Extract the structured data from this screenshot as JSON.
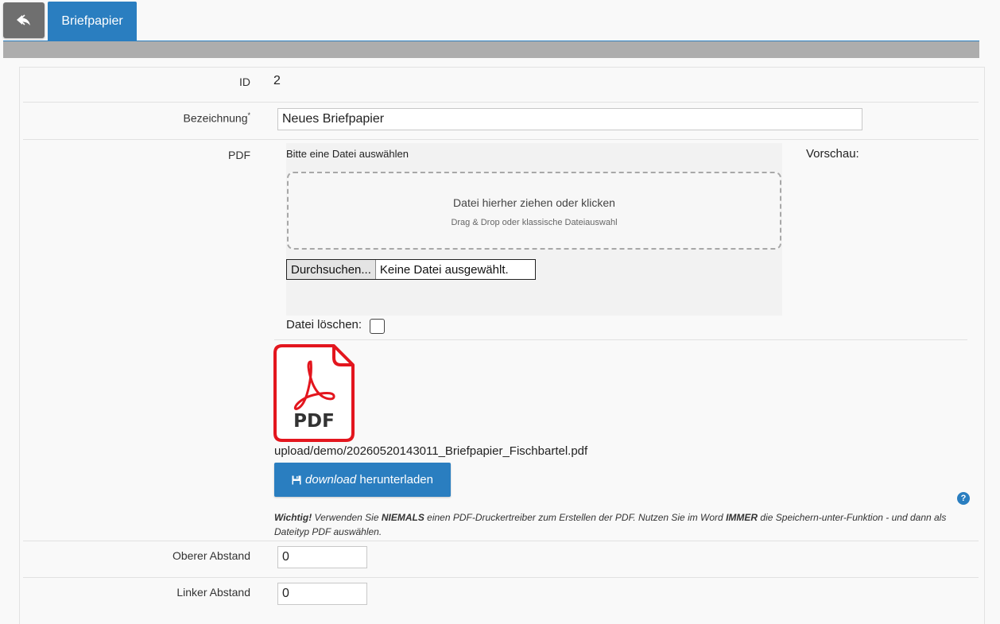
{
  "tabs": {
    "active_label": "Briefpapier"
  },
  "form": {
    "id": {
      "label": "ID",
      "value": "2"
    },
    "bezeichnung": {
      "label": "Bezeichnung",
      "required_mark": "*",
      "value": "Neues Briefpapier"
    },
    "pdf": {
      "label": "PDF",
      "select_hint": "Bitte eine Datei auswählen",
      "preview_label": "Vorschau:",
      "dropzone_title": "Datei hierher ziehen oder klicken",
      "dropzone_subtitle": "Drag & Drop oder klassische Dateiauswahl",
      "browse_label": "Durchsuchen...",
      "no_file_label": "Keine Datei ausgewählt.",
      "delete_label": "Datei löschen:",
      "icon_text": "PDF",
      "file_path": "upload/demo/20260520143011_Briefpapier_Fischbartel.pdf",
      "download_italic": "download",
      "download_text": "herunterladen",
      "note_prefix": "Wichtig!",
      "note_part1": " Verwenden Sie ",
      "note_strong1": "NIEMALS",
      "note_part2": " einen PDF-Druckertreiber zum Erstellen der PDF. Nutzen Sie im Word ",
      "note_strong2": "IMMER",
      "note_part3": " die Speichern-unter-Funktion - und dann als Dateityp PDF auswählen.",
      "help_symbol": "?"
    },
    "oberer_abstand": {
      "label": "Oberer Abstand",
      "value": "0"
    },
    "linker_abstand": {
      "label": "Linker Abstand",
      "value": "0"
    }
  },
  "colors": {
    "primary": "#2a7ec0",
    "back_button": "#6f6f6f",
    "pdf_red": "#e3161e"
  }
}
